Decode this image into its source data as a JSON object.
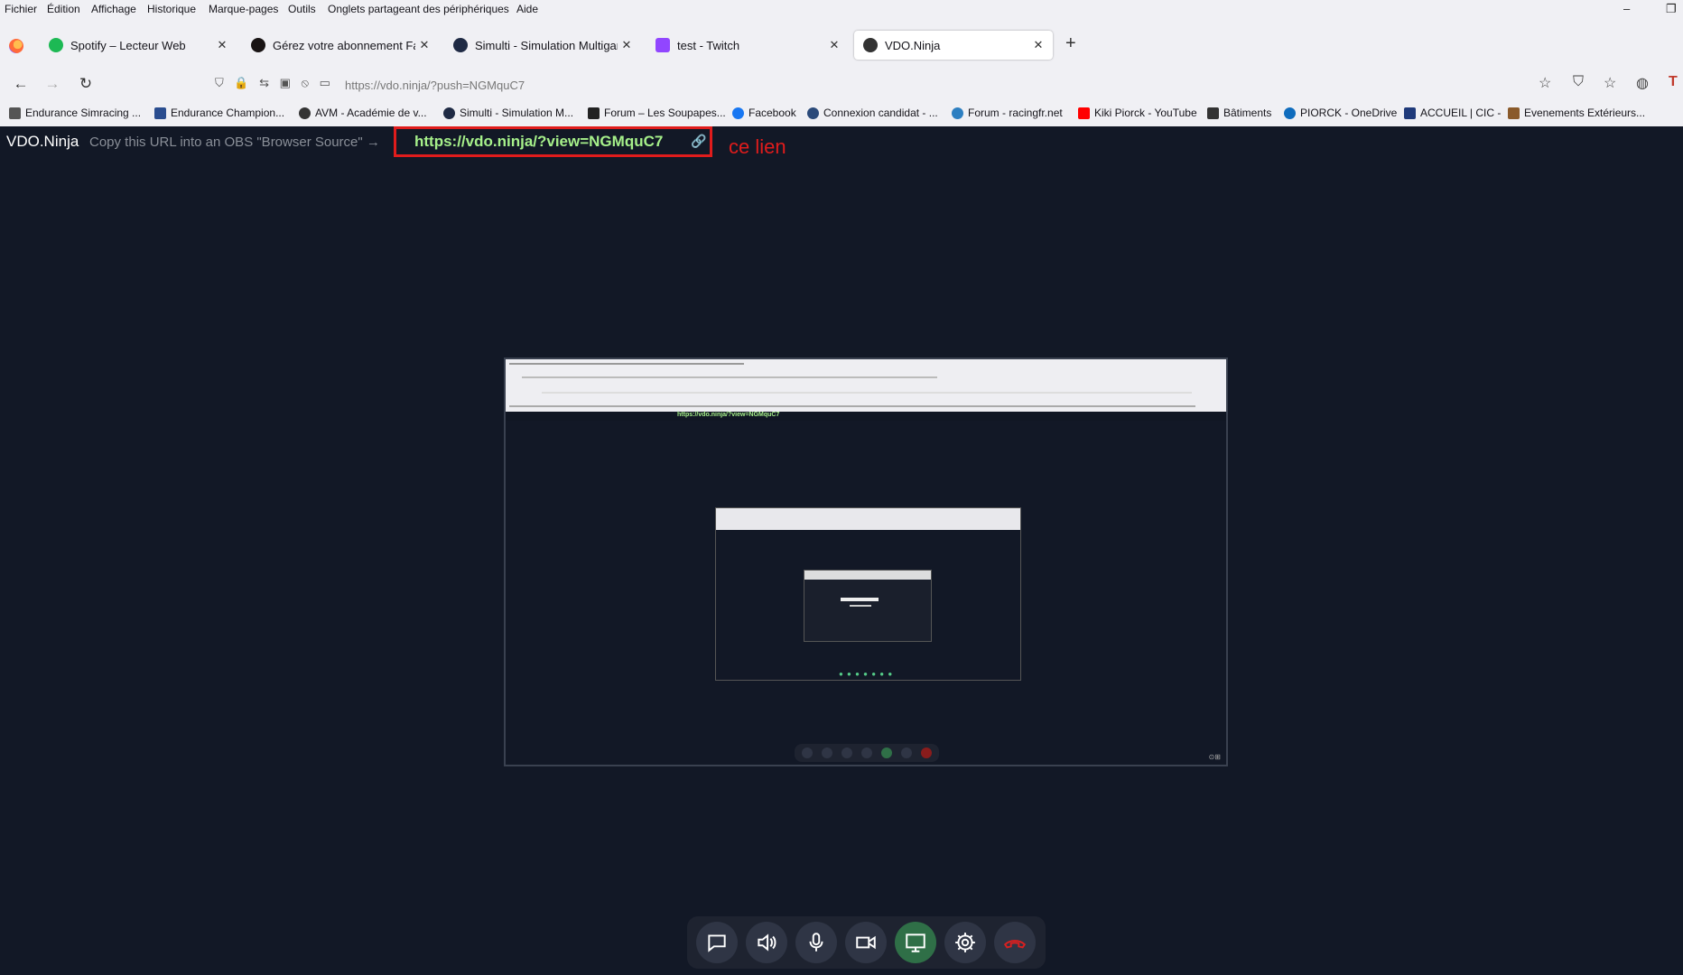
{
  "menubar": {
    "items": [
      "Fichier",
      "Édition",
      "Affichage",
      "Historique",
      "Marque-pages",
      "Outils",
      "Onglets partageant des périphériques",
      "Aide"
    ],
    "window_controls": {
      "minimize": "–",
      "restore": "❐"
    }
  },
  "tabs": [
    {
      "title": "Spotify – Lecteur Web",
      "icon": "spotify-icon",
      "active": false,
      "close": "✕"
    },
    {
      "title": "Gérez votre abonnement Famille",
      "icon": "spotify-icon",
      "active": false,
      "close": "✕"
    },
    {
      "title": "Simulti - Simulation Multigaming",
      "icon": "simulti-icon",
      "active": false,
      "close": "✕"
    },
    {
      "title": "test - Twitch",
      "icon": "twitch-icon",
      "active": false,
      "close": "✕"
    },
    {
      "title": "VDO.Ninja",
      "icon": "vdo-ninja-icon",
      "active": true,
      "close": "✕"
    }
  ],
  "new_tab": "+",
  "navigation": {
    "back": "←",
    "forward": "→",
    "reload": "↻",
    "url": "https://vdo.ninja/?push=NGMquC7"
  },
  "bookmarks": [
    {
      "label": "Endurance Simracing ...",
      "icon": "tools-icon",
      "color": "#555555"
    },
    {
      "label": "Endurance Champion...",
      "icon": "fia-icon",
      "color": "#2a4d8f"
    },
    {
      "label": "AVM - Académie de v...",
      "icon": "avm-icon",
      "color": "#333333"
    },
    {
      "label": "Simulti - Simulation M...",
      "icon": "simulti-icon",
      "color": "#1f2a44"
    },
    {
      "label": "Forum – Les Soupapes...",
      "icon": "forum-icon",
      "color": "#222222"
    },
    {
      "label": "Facebook",
      "icon": "facebook-icon",
      "color": "#1877f2"
    },
    {
      "label": "Connexion candidat - ...",
      "icon": "candidate-icon",
      "color": "#2b4a7a"
    },
    {
      "label": "Forum - racingfr.net",
      "icon": "racingfr-icon",
      "color": "#2d7fc1"
    },
    {
      "label": "Kiki Piorck - YouTube",
      "icon": "youtube-icon",
      "color": "#ff0000"
    },
    {
      "label": "Bâtiments",
      "icon": "tools-icon",
      "color": "#333333"
    },
    {
      "label": "PIORCK - OneDrive",
      "icon": "onedrive-icon",
      "color": "#0f6cbd"
    },
    {
      "label": "ACCUEIL | CIC -",
      "icon": "cic-icon",
      "color": "#1f3a7a"
    },
    {
      "label": "Evenements Extérieurs...",
      "icon": "event-icon",
      "color": "#8a5a2b"
    }
  ],
  "vdo": {
    "brand": "VDO.Ninja",
    "instruction": "Copy this URL into an OBS \"Browser Source\" →",
    "share_link": "https://vdo.ninja/?view=NGMquC7",
    "annotation": "ce lien"
  },
  "preview": {
    "link": "https://vdo.ninja/?view=NGMquC7"
  },
  "controls": [
    {
      "name": "chat-button",
      "icon": "chat-icon"
    },
    {
      "name": "speaker-button",
      "icon": "speaker-icon"
    },
    {
      "name": "microphone-button",
      "icon": "microphone-icon"
    },
    {
      "name": "camera-button",
      "icon": "camera-icon"
    },
    {
      "name": "screen-share-button",
      "icon": "screen-share-icon",
      "active": true
    },
    {
      "name": "settings-button",
      "icon": "gear-icon"
    },
    {
      "name": "hangup-button",
      "icon": "hangup-icon",
      "color": "#d92020"
    }
  ],
  "colors": {
    "page_bg": "#121826",
    "link_green": "#a6f08a",
    "annotation_red": "#e01c1c",
    "active_green": "#2f6f47"
  }
}
